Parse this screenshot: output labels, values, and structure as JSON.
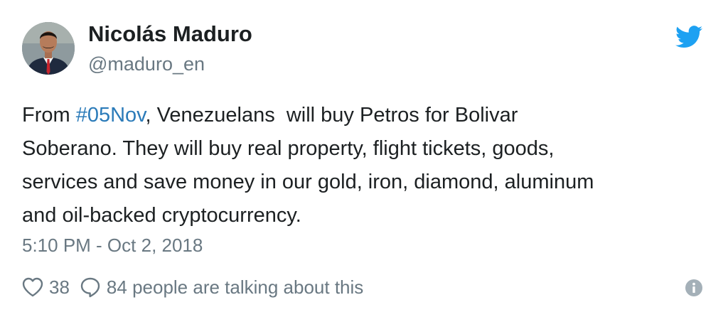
{
  "author": {
    "name": "Nicolás Maduro",
    "handle": "@maduro_en",
    "avatar": "profile-photo"
  },
  "tweet": {
    "lines": [
      {
        "before": "From ",
        "hashtag": "#05Nov",
        "after": ", Venezuelans  will buy Petros for Bolivar"
      },
      {
        "text": "Soberano. They will buy real property, flight tickets, goods,"
      },
      {
        "text": "services and save money in our gold, iron, diamond, aluminum"
      },
      {
        "text": "and oil-backed cryptocurrency."
      }
    ],
    "timestamp": "5:10 PM - Oct 2, 2018"
  },
  "actions": {
    "likes_count": "38",
    "replies_text": "84 people are talking about this"
  },
  "icons": {
    "brand": "twitter-bird-icon",
    "like": "heart-icon",
    "reply": "speech-bubble-icon",
    "info": "info-icon"
  },
  "colors": {
    "twitter_blue": "#1da1f2",
    "hashtag": "#2b7bb9",
    "text": "#1c2022",
    "secondary": "#697882",
    "info_icon": "#a4b0b8"
  }
}
